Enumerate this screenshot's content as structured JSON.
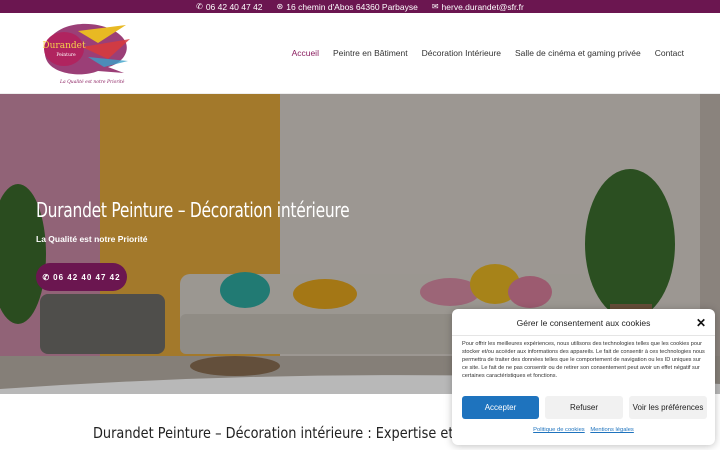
{
  "topbar": {
    "phone": "06 42 40 47 42",
    "address": "16 chemin d'Abos 64360 Parbayse",
    "email": "herve.durandet@sfr.fr",
    "icons": [
      "phone-icon",
      "location-icon",
      "mail-icon"
    ]
  },
  "logo": {
    "name": "Durandet",
    "sub": "Peinture",
    "tagline": "La Qualité est notre Priorité"
  },
  "nav": {
    "items": [
      {
        "label": "Accueil"
      },
      {
        "label": "Peintre en Bâtiment"
      },
      {
        "label": "Décoration Intérieure"
      },
      {
        "label": "Salle de cinéma et gaming privée"
      },
      {
        "label": "Contact"
      }
    ]
  },
  "hero": {
    "title": "Durandet Peinture – Décoration intérieure",
    "subtitle": "La Qualité est notre Priorité",
    "cta_label": "06 42 40 47 42"
  },
  "section": {
    "title": "Durandet Peinture – Décoration intérieure : Expertise et Créat"
  },
  "cookie": {
    "title": "Gérer le consentement aux cookies",
    "body": "Pour offrir les meilleures expériences, nous utilisons des technologies telles que les cookies pour stocker et/ou accéder aux informations des appareils. Le fait de consentir à ces technologies nous permettra de traiter des données telles que le comportement de navigation ou les ID uniques sur ce site. Le fait de ne pas consentir ou de retirer son consentement peut avoir un effet négatif sur certaines caractéristiques et fonctions.",
    "accept": "Accepter",
    "refuse": "Refuser",
    "prefs": "Voir les préférences",
    "link_policy": "Politique de cookies",
    "link_legal": "Mentions légales"
  },
  "colors": {
    "brand": "#6b1650",
    "accept_button": "#1e73be"
  }
}
